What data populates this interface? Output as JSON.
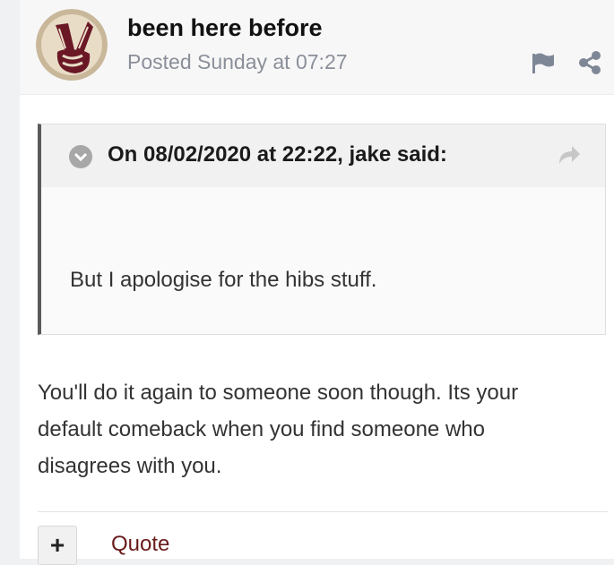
{
  "post": {
    "author": "been here before",
    "posted": "Posted Sunday at 07:27"
  },
  "quote": {
    "citation": "On 08/02/2020 at 22:22, jake said:",
    "text": "But I apologise for the hibs stuff."
  },
  "body": {
    "lines": [
      "You'll do it again to someone soon though. Its your",
      "default comeback when you find someone who",
      "disagrees with you."
    ]
  },
  "actions": {
    "plus_label": "+",
    "quote_label": "Quote"
  },
  "icons": {
    "avatar": "victory-hand-avatar",
    "report": "flag-icon",
    "share": "share-icon",
    "toggle": "chevron-down-circle-icon",
    "goto": "forward-arrow-icon"
  },
  "colors": {
    "avatar_maroon": "#6b1826",
    "quote_border": "#5a5a5a",
    "quote_link": "#6a1a1a",
    "meta_gray": "#8a8f99"
  }
}
